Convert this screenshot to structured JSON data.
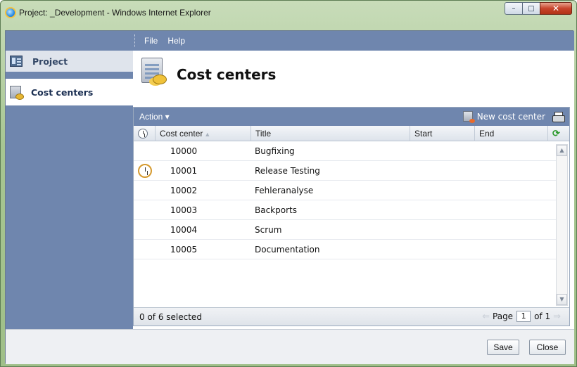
{
  "window": {
    "title": "Project: _Development - Windows Internet Explorer",
    "minimize": "–",
    "maximize": "□",
    "close": "✕"
  },
  "menu": {
    "items": [
      "File",
      "Help"
    ]
  },
  "sidebar": {
    "items": [
      {
        "label": "Project",
        "icon": "project-icon"
      },
      {
        "label": "Cost centers",
        "icon": "cost-center-icon"
      }
    ]
  },
  "page": {
    "title": "Cost centers"
  },
  "toolbar": {
    "action_label": "Action ▾",
    "new_label": "New cost center"
  },
  "grid": {
    "columns": [
      "Cost center",
      "Title",
      "Start",
      "End"
    ],
    "sort_indicator": "▲",
    "refresh_icon": "⟳",
    "rows": [
      {
        "cost_center": "10000",
        "title": "Bugfixing",
        "start": "",
        "end": "",
        "has_icon": false
      },
      {
        "cost_center": "10001",
        "title": "Release Testing",
        "start": "",
        "end": "",
        "has_icon": true
      },
      {
        "cost_center": "10002",
        "title": "Fehleranalyse",
        "start": "",
        "end": "",
        "has_icon": false
      },
      {
        "cost_center": "10003",
        "title": "Backports",
        "start": "",
        "end": "",
        "has_icon": false
      },
      {
        "cost_center": "10004",
        "title": "Scrum",
        "start": "",
        "end": "",
        "has_icon": false
      },
      {
        "cost_center": "10005",
        "title": "Documentation",
        "start": "",
        "end": "",
        "has_icon": false
      }
    ],
    "selection_status": "0 of 6 selected",
    "pager": {
      "page_label": "Page",
      "current_page": "1",
      "of_label": "of 1",
      "prev_icon": "⇐",
      "next_icon": "⇒"
    }
  },
  "buttons": {
    "save": "Save",
    "close": "Close"
  },
  "colors": {
    "header_blue": "#6f86ae",
    "frame_green": "#a7c692"
  }
}
